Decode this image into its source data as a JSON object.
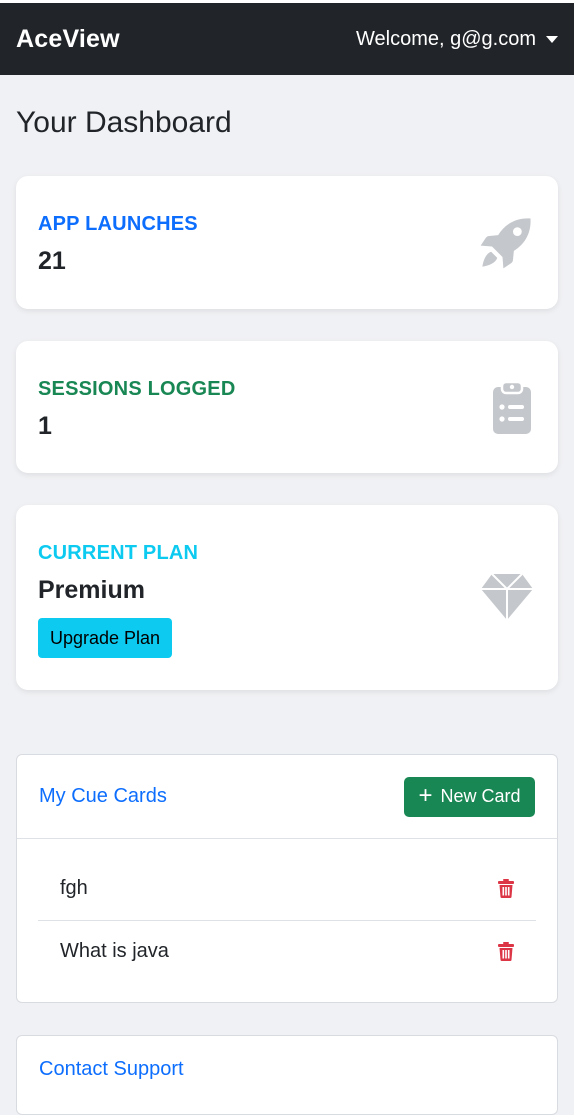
{
  "navbar": {
    "brand": "AceView",
    "welcome": "Welcome, g@g.com"
  },
  "page": {
    "title": "Your Dashboard"
  },
  "stats": {
    "app_launches": {
      "label": "APP LAUNCHES",
      "value": "21",
      "color": "#0d6efd",
      "icon": "rocket-icon"
    },
    "sessions_logged": {
      "label": "SESSIONS LOGGED",
      "value": "1",
      "color": "#198754",
      "icon": "clipboard-list-icon"
    },
    "current_plan": {
      "label": "CURRENT PLAN",
      "value": "Premium",
      "color": "#0dcaf0",
      "icon": "gem-icon",
      "button": "Upgrade Plan"
    }
  },
  "cue_cards": {
    "title": "My Cue Cards",
    "new_button": "New Card",
    "items": [
      {
        "text": "fgh",
        "icon": "trash-icon"
      },
      {
        "text": "What is java",
        "icon": "trash-icon"
      }
    ]
  },
  "support": {
    "title": "Contact Support"
  },
  "colors": {
    "navbar_bg": "#212529",
    "page_bg": "#f0f1f4",
    "primary": "#0d6efd",
    "success": "#198754",
    "info": "#0dcaf0",
    "danger": "#dc3545",
    "icon_gray": "#c4c7cb"
  }
}
